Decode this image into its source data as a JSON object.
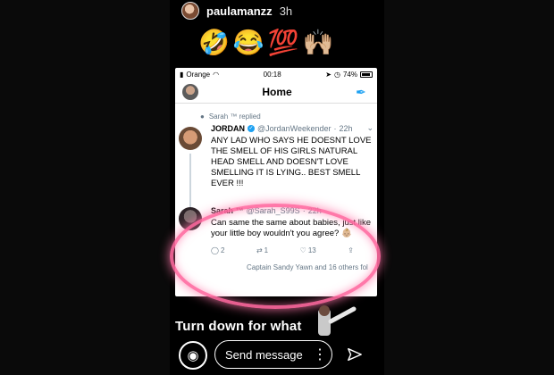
{
  "story": {
    "username": "paulamanzz",
    "time_ago": "3h",
    "emojis": [
      "🤣",
      "😂",
      "💯",
      "🙌🏼"
    ],
    "caption": "Turn down for what",
    "message_placeholder": "Send message"
  },
  "screenshot": {
    "status": {
      "carrier": "Orange",
      "time": "00:18",
      "battery": "74%"
    },
    "nav": {
      "title": "Home"
    },
    "replied_note": "Sarah ™ replied",
    "tweet": {
      "name": "JORDAN",
      "handle": "@JordanWeekender",
      "time": "22h",
      "text": "ANY LAD WHO SAYS HE DOESNT LOVE THE SMELL OF HIS GIRLS NATURAL HEAD SMELL AND DOESN'T LOVE SMELLING IT IS LYING.. BEST SMELL EVER !!!"
    },
    "reply": {
      "name": "Sarah ™",
      "handle": "@Sarah_S99S",
      "time": "22h",
      "text": "Can same the same about babies, just like your little boy wouldn't you agree? 👶🏼",
      "counts": {
        "replies": "2",
        "retweets": "1",
        "likes": "13"
      }
    },
    "footer_note": "Captain Sandy Yawn and 16 others fol"
  },
  "colors": {
    "accent_blue": "#1da1f2",
    "highlight_pink": "#ff69a0"
  }
}
